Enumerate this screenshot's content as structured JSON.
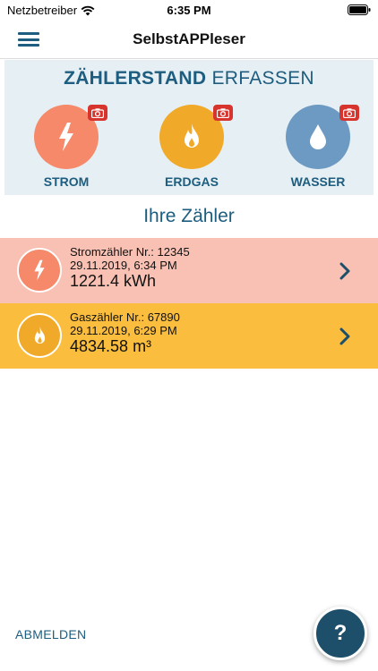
{
  "status_bar": {
    "carrier": "Netzbetreiber",
    "time": "6:35 PM"
  },
  "nav": {
    "title": "SelbstAPPleser"
  },
  "capture": {
    "heading_bold": "ZÄHLERSTAND",
    "heading_light": "ERFASSEN",
    "types": [
      {
        "label": "STROM",
        "icon": "lightning-icon",
        "color": "#f5896a"
      },
      {
        "label": "ERDGAS",
        "icon": "flame-icon",
        "color": "#f0a928"
      },
      {
        "label": "WASSER",
        "icon": "water-drop-icon",
        "color": "#6d9ac2"
      }
    ]
  },
  "section_title": "Ihre Zähler",
  "meters": [
    {
      "name": "Stromzähler Nr.: 12345",
      "datetime": "29.11.2019, 6:34 PM",
      "reading": "1221.4 kWh",
      "icon": "lightning-icon",
      "row_color": "#f9c1b3",
      "icon_color": "#f5896a"
    },
    {
      "name": "Gaszähler Nr.: 67890",
      "datetime": "29.11.2019, 6:29 PM",
      "reading": "4834.58 m³",
      "icon": "flame-icon",
      "row_color": "#fbbd3d",
      "icon_color": "#f0a928"
    }
  ],
  "logout_label": "ABMELDEN",
  "help_label": "?",
  "colors": {
    "accent": "#1d5d7f",
    "help_button": "#1d4f6b",
    "camera_badge": "#d7342d"
  }
}
